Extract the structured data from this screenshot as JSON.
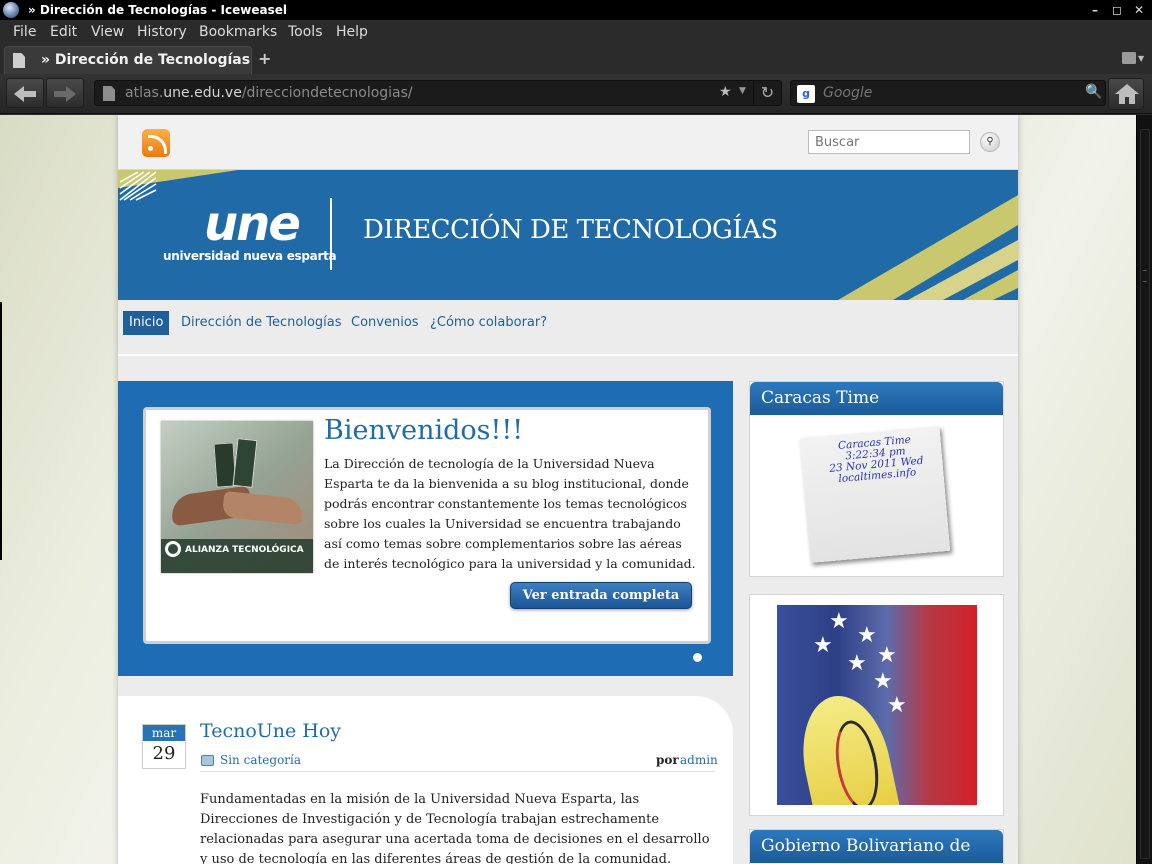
{
  "window": {
    "title": "» Dirección de Tecnologías - Iceweasel",
    "controls": [
      "–",
      "◻",
      "✕"
    ]
  },
  "menu": [
    "File",
    "Edit",
    "View",
    "History",
    "Bookmarks",
    "Tools",
    "Help"
  ],
  "tabs": [
    {
      "label": "» Dirección de Tecnologías",
      "active": true
    }
  ],
  "new_tab_label": "+",
  "nav": {
    "url_host_pre": "atlas.",
    "url_host": "une.edu.ve",
    "url_path": "/direcciondetecnologias/",
    "search_placeholder": "Google",
    "search_engine_icon": "g"
  },
  "site": {
    "search_placeholder": "Buscar",
    "logo": {
      "main": "une",
      "sub": "universidad nueva esparta"
    },
    "banner_title": "DIRECCIÓN DE TECNOLOGÍAS",
    "menu": [
      {
        "label": "Inicio",
        "active": true
      },
      {
        "label": "Dirección de Tecnologías",
        "active": false
      },
      {
        "label": "Convenios",
        "active": false
      },
      {
        "label": "¿Cómo colaborar?",
        "active": false
      }
    ],
    "slide": {
      "image_caption": "ALIANZA TECNOLÓGICA",
      "title": "Bienvenidos!!!",
      "text": "La Dirección de tecnología de la Universidad Nueva Esparta te da la bienvenida a su blog institucional, donde podrás encontrar constantemente los temas tecnológicos sobre los cuales la Universidad se encuentra trabajando así como temas sobre complementarios sobre las aéreas de interés tecnológico para la universidad y la comunidad.",
      "button": "Ver entrada completa"
    },
    "post": {
      "month": "mar",
      "day": "29",
      "title": "TecnoUne Hoy",
      "category": "Sin categoría",
      "by": "por",
      "author": "admin",
      "body": "Fundamentadas en la misión de la Universidad Nueva Esparta, las Direcciones de Investigación y de Tecnología trabajan estrechamente relacionadas para asegurar una acertada toma de decisiones en el desarrollo y uso de tecnología en las diferentes áreas de gestión de la comunidad."
    },
    "widgets": {
      "clock": {
        "title": "Caracas Time",
        "lines": [
          "Caracas Time",
          "3:22:34 pm",
          "23 Nov 2011 Wed",
          "localtimes.info"
        ]
      },
      "gov": {
        "title": "Gobierno Bolivariano de"
      }
    }
  },
  "colors": {
    "accent": "#1e6da8",
    "banner": "#1f6aa7",
    "chrome": "#2b2b2b",
    "stripe": "#c9c86e"
  }
}
